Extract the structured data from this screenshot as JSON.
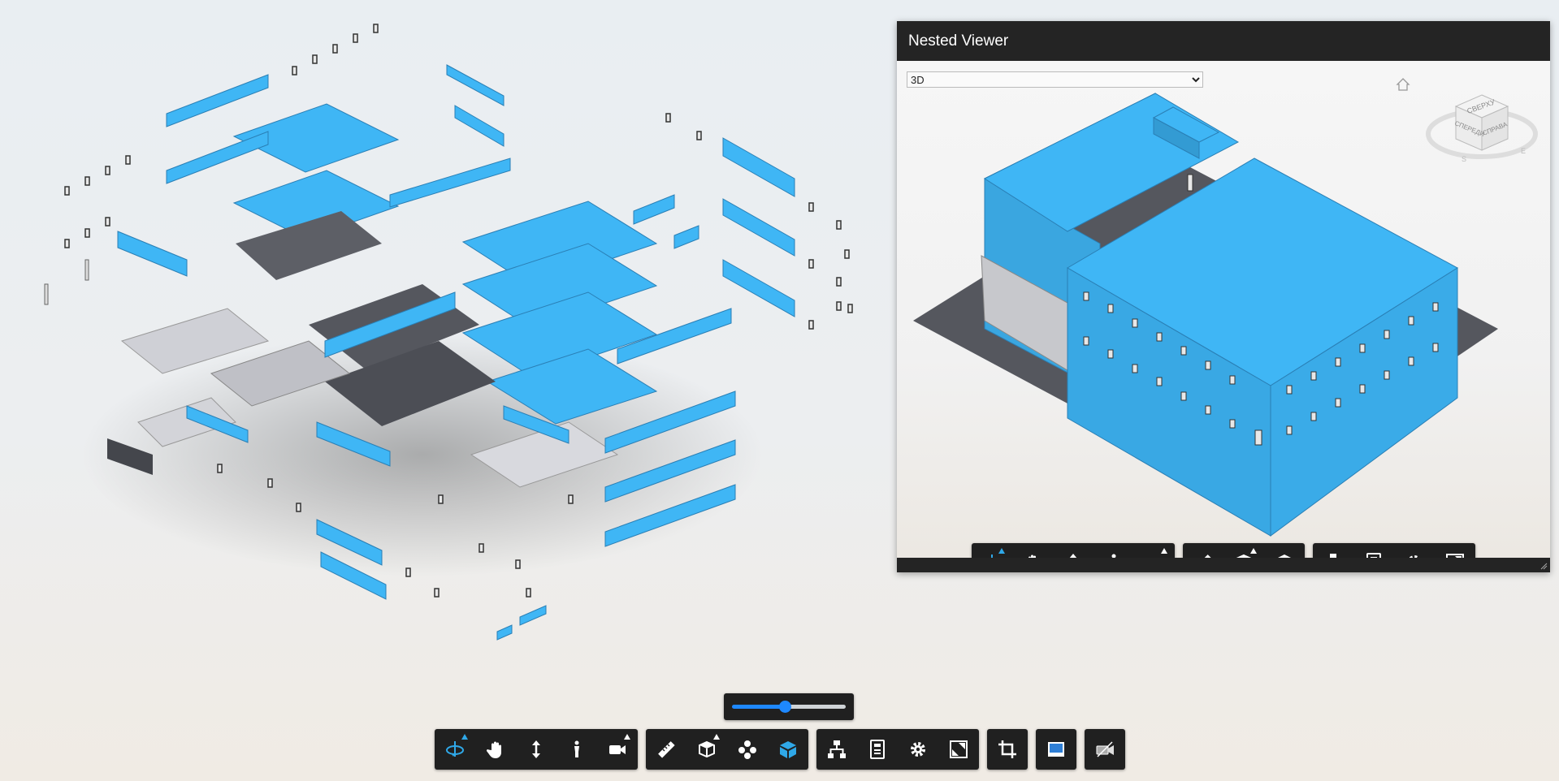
{
  "nested_viewer": {
    "title": "Nested Viewer",
    "view_select_value": "3D",
    "view_select_options": [
      "3D"
    ],
    "viewcube_faces": [
      "СВЕРХУ",
      "СПЕРЕДИ",
      "СПРАВА"
    ],
    "compass_letters": [
      "S",
      "E"
    ]
  },
  "main_toolbar": {
    "groups": [
      [
        "orbit-icon",
        "pan-icon",
        "zoom-icon",
        "first-person-icon",
        "camera-icon"
      ],
      [
        "measure-icon",
        "section-icon",
        "explode-icon",
        "model-browser-icon"
      ],
      [
        "structure-icon",
        "properties-icon",
        "settings-icon",
        "fullscreen-icon"
      ],
      [
        "crop-icon"
      ],
      [
        "split-view-icon"
      ],
      [
        "viewer-icon"
      ]
    ],
    "explode_level": 0.47
  },
  "colors": {
    "accent": "#2fa8e8",
    "model_blue": "#3fb6f5",
    "toolbar_bg": "#202020",
    "header_bg": "#242424"
  }
}
